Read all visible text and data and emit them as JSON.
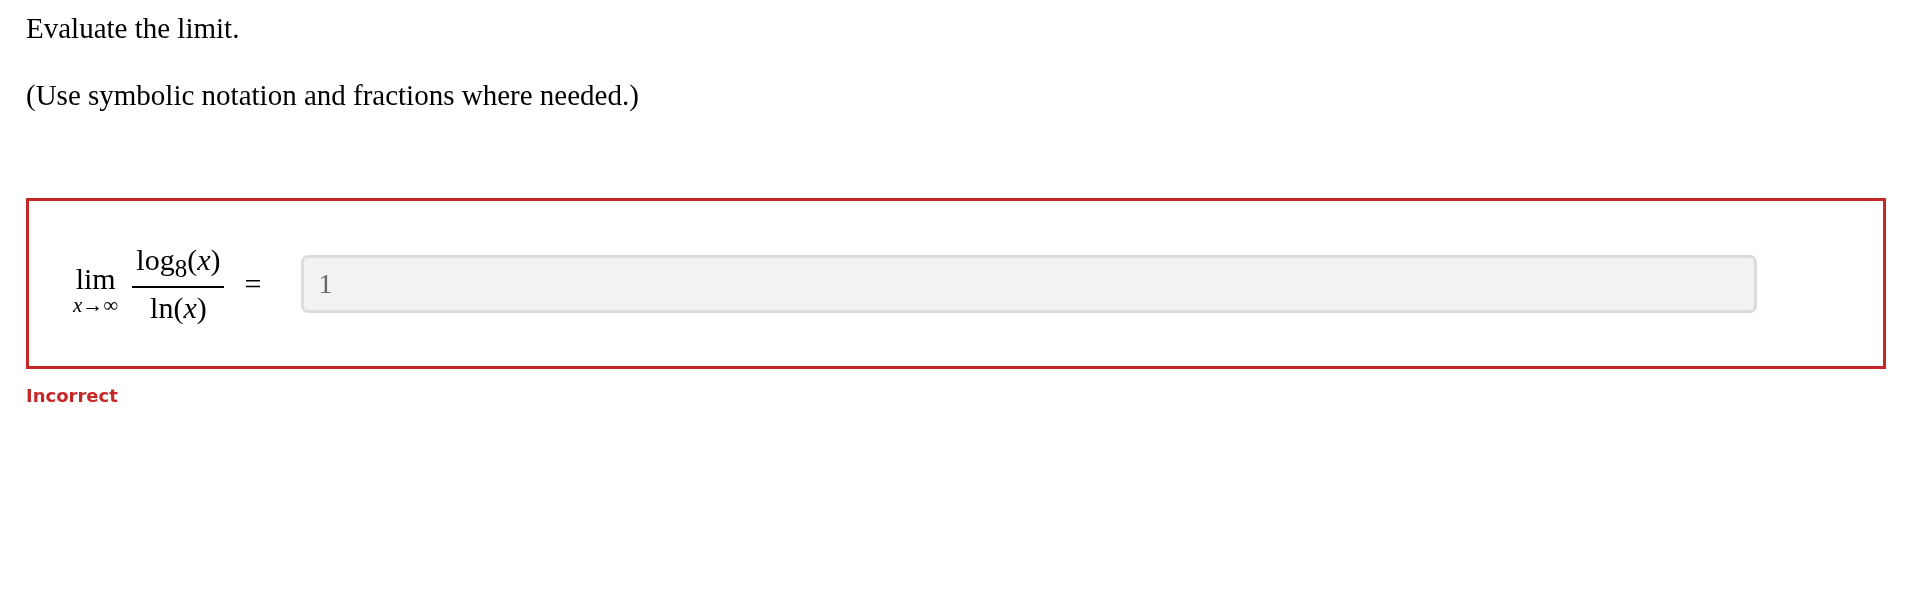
{
  "prompt": "Evaluate the limit.",
  "instruction": "(Use symbolic notation and fractions where needed.)",
  "question": {
    "correct": false,
    "limit": {
      "operator": "lim",
      "under": "*x*→∞",
      "numerator": "log$_{8}$(*x*)",
      "denominator": "ln(*x*)",
      "equals": "="
    },
    "answer": {
      "value": "1",
      "disabled": true
    },
    "feedback": "Incorrect"
  }
}
